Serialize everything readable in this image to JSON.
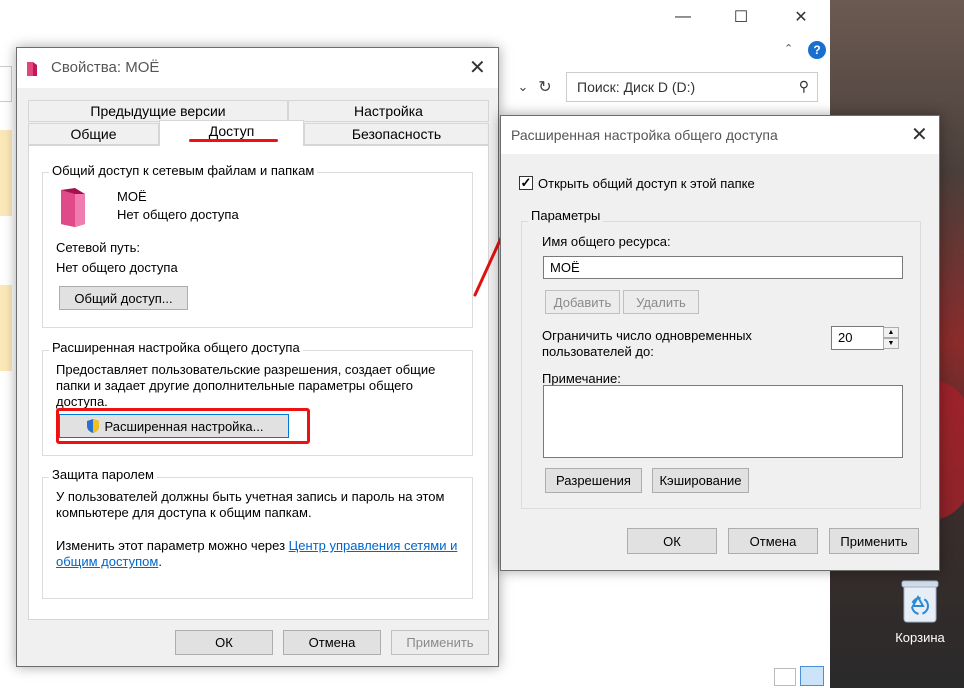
{
  "explorer": {
    "search_placeholder": "Поиск: Диск D (D:)",
    "min_label": "—",
    "max_label": "☐",
    "close_label": "✕",
    "help_label": "?"
  },
  "desktop": {
    "recycle_bin_label": "Корзина"
  },
  "props": {
    "title": "Свойства: МОЁ",
    "tabs_row1": [
      "Предыдущие версии",
      "Настройка"
    ],
    "tabs_row2": [
      "Общие",
      "Доступ",
      "Безопасность"
    ],
    "share_group_label": "Общий доступ к сетевым файлам и папкам",
    "folder_name": "МОЁ",
    "folder_status": "Нет общего доступа",
    "network_path_label": "Сетевой путь:",
    "network_path_value": "Нет общего доступа",
    "share_button": "Общий доступ...",
    "adv_group_label": "Расширенная настройка общего доступа",
    "adv_desc": "Предоставляет пользовательские разрешения, создает общие папки и задает другие дополнительные параметры общего доступа.",
    "adv_button": "Расширенная настройка...",
    "pwd_group_label": "Защита паролем",
    "pwd_desc": "У пользователей должны быть учетная запись и пароль на этом компьютере для доступа к общим папкам.",
    "pwd_change_prefix": "Изменить этот параметр можно через ",
    "pwd_link": "Центр управления сетями и общим доступом",
    "pwd_change_suffix": ".",
    "ok": "ОК",
    "cancel": "Отмена",
    "apply": "Применить"
  },
  "adv": {
    "title": "Расширенная настройка общего доступа",
    "share_checkbox_label": "Открыть общий доступ к этой папке",
    "share_checked": true,
    "params_label": "Параметры",
    "share_name_label": "Имя общего ресурса:",
    "share_name_value": "МОЁ",
    "add_button": "Добавить",
    "remove_button": "Удалить",
    "limit_label": "Ограничить число одновременных пользователей до:",
    "limit_value": "20",
    "note_label": "Примечание:",
    "note_value": "",
    "permissions_button": "Разрешения",
    "caching_button": "Кэширование",
    "ok": "ОК",
    "cancel": "Отмена",
    "apply": "Применить"
  },
  "colors": {
    "annotation_red": "#e11111",
    "link_blue": "#0066cc"
  }
}
